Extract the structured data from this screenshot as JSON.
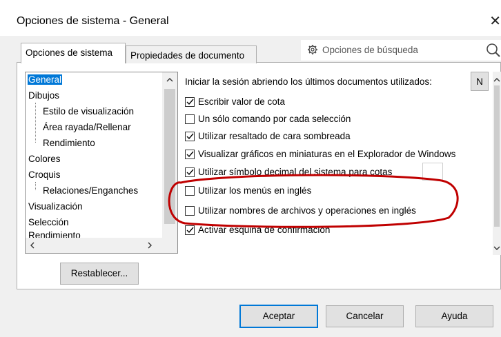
{
  "window": {
    "title": "Opciones de sistema - General",
    "close_glyph": "✕"
  },
  "tabs": [
    {
      "label": "Opciones de sistema",
      "active": true
    },
    {
      "label": "Propiedades de documento",
      "active": false
    }
  ],
  "search": {
    "placeholder": "Opciones de búsqueda",
    "gear_icon": "gear-icon",
    "magnifier_icon": "search-icon"
  },
  "tree": {
    "items": [
      {
        "label": "General",
        "selected": true
      },
      {
        "label": "Dibujos"
      },
      {
        "label": "Estilo de visualización"
      },
      {
        "label": "Área rayada/Rellenar"
      },
      {
        "label": "Rendimiento"
      },
      {
        "label": "Colores"
      },
      {
        "label": "Croquis"
      },
      {
        "label": "Relaciones/Enganches"
      },
      {
        "label": "Visualización"
      },
      {
        "label": "Selección"
      },
      {
        "label": "Rendimiento"
      }
    ]
  },
  "buttons": {
    "reset": "Restablecer...",
    "accept": "Aceptar",
    "cancel": "Cancelar",
    "help": "Ayuda"
  },
  "options": {
    "startup_label": "Iniciar la sesión abriendo los últimos documentos utilizados:",
    "startup_value": "N",
    "checkboxes": [
      {
        "label": "Escribir valor de cota",
        "checked": true
      },
      {
        "label": "Un sólo comando por cada selección",
        "checked": false
      },
      {
        "label": "Utilizar resaltado de cara sombreada",
        "checked": true
      },
      {
        "label": "Visualizar gráficos en miniaturas en el Explorador de Windows",
        "checked": true
      },
      {
        "label": "Utilizar símbolo decimal del sistema para cotas",
        "checked": true
      },
      {
        "label": "Utilizar los menús en inglés",
        "checked": false
      },
      {
        "label": "Utilizar nombres de archivos y operaciones en inglés",
        "checked": false
      },
      {
        "label": "Activar esquina de confirmación",
        "checked": true
      }
    ]
  },
  "colors": {
    "selection": "#0078d7",
    "annotation": "#c00000"
  }
}
